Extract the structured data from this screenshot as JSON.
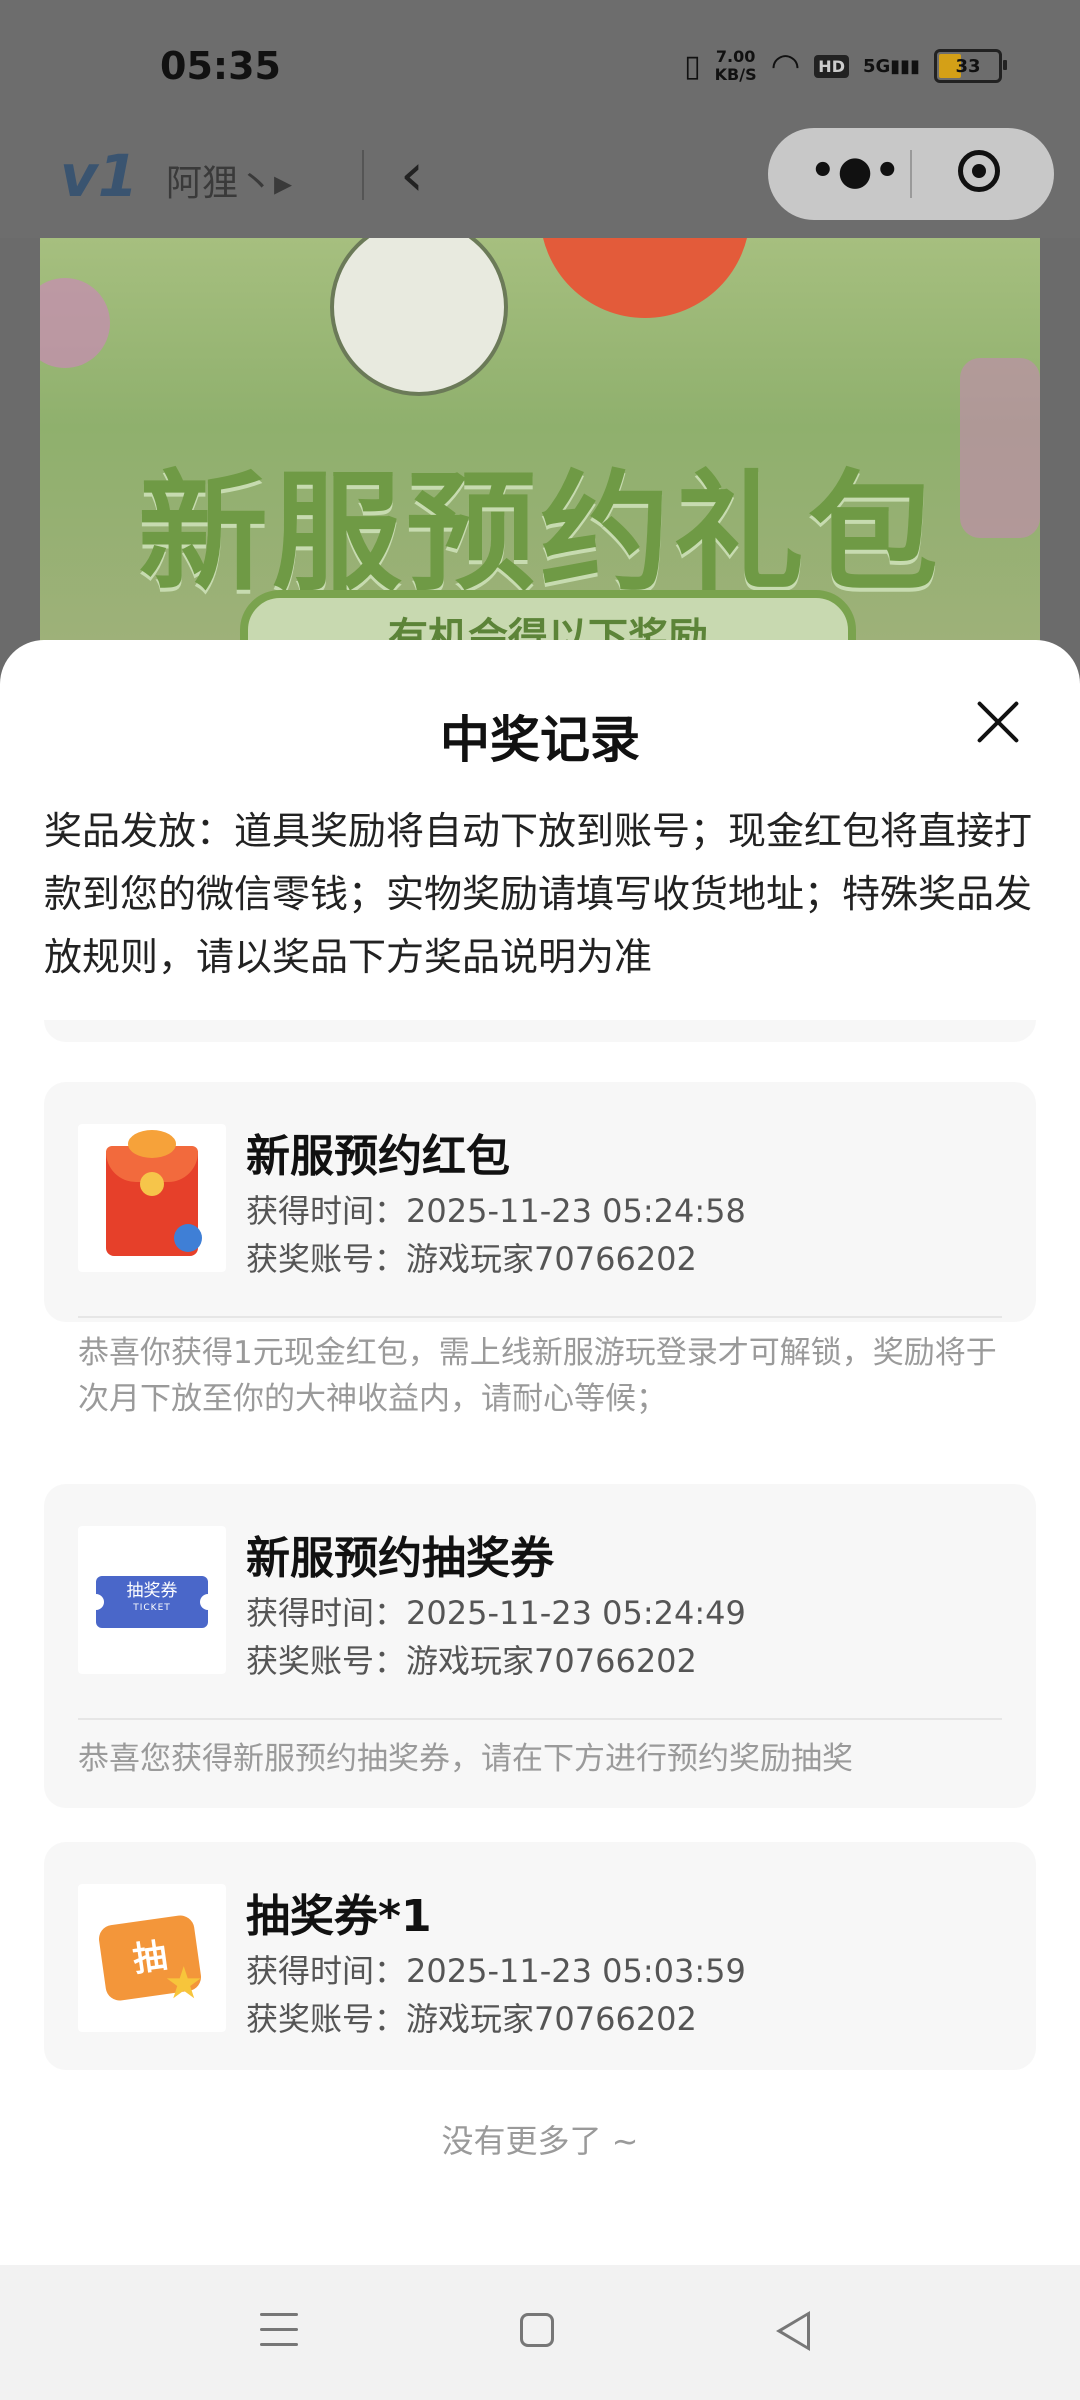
{
  "status": {
    "time": "05:35",
    "net_speed_value": "7.00",
    "net_speed_unit": "KB/S",
    "hd_label": "HD",
    "network": "5G",
    "battery": "33"
  },
  "appbar": {
    "logo": "v1",
    "title": "阿狸丶▸",
    "back_icon": "chevron-left-icon",
    "more_icon": "more-dots-icon",
    "close_icon": "target-icon"
  },
  "banner": {
    "title": "新服预约礼包",
    "subtitle": "有机会得以下奖励"
  },
  "sheet": {
    "title": "中奖记录",
    "notice": "奖品发放：道具奖励将自动下放到账号；现金红包将直接打款到您的微信零钱；实物奖励请填写收货地址；特殊奖品发放规则，请以奖品下方奖品说明为准",
    "no_more": "没有更多了 ~"
  },
  "records": [
    {
      "name": "新服预约红包",
      "time_label": "获得时间：",
      "time": "2025-11-23 05:24:58",
      "account_label": "获奖账号：",
      "account": "游戏玩家70766202",
      "desc": "恭喜你获得1元现金红包，需上线新服游玩登录才可解锁，奖励将于次月下放至你的大神收益内，请耐心等候；"
    },
    {
      "name": "新服预约抽奖券",
      "time_label": "获得时间：",
      "time": "2025-11-23 05:24:49",
      "account_label": "获奖账号：",
      "account": "游戏玩家70766202",
      "desc": "恭喜您获得新服预约抽奖券，请在下方进行预约奖励抽奖",
      "thumb_text": "抽奖券",
      "thumb_sub": "TICKET"
    },
    {
      "name": "抽奖券*1",
      "time_label": "获得时间：",
      "time": "2025-11-23 05:03:59",
      "account_label": "获奖账号：",
      "account": "游戏玩家70766202",
      "thumb_text": "抽"
    }
  ]
}
